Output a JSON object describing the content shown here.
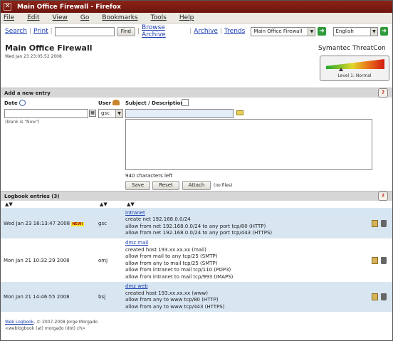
{
  "window": {
    "title": "Main Office Firewall - Firefox"
  },
  "menu": [
    "File",
    "Edit",
    "View",
    "Go",
    "Bookmarks",
    "Tools",
    "Help"
  ],
  "nav": {
    "search": "Search",
    "print": "Print",
    "search_value": "",
    "find_button": "Find",
    "browse_archive": "Browse Archive",
    "archive": "Archive",
    "trends": "Trends",
    "logbook_select": "Main Office Firewall",
    "language_select": "English"
  },
  "page": {
    "title": "Main Office Firewall",
    "date": "Wed Jan 23 23:05:52 2008"
  },
  "threatcon": {
    "title": "Symantec ThreatCon",
    "level_text": "Level 1: Normal",
    "level_fraction": 0.25
  },
  "new_entry": {
    "section_title": "Add a new entry",
    "date_label": "Date",
    "date_hint": "(blank is \"Now\")",
    "user_label": "User",
    "user_value": "gsc",
    "subject_label": "Subject / Description",
    "subject_value": "",
    "description_value": "",
    "chars_left": "940 characters left",
    "save": "Save",
    "reset": "Reset",
    "attach": "Attach",
    "no_files": "(no files)"
  },
  "logbook": {
    "section_title": "Logbook entries (3)",
    "entries": [
      {
        "date": "Wed Jan 23 16:13:47 2008",
        "new": "NEW!",
        "user": "gsc",
        "subject": "intranet",
        "lines": [
          "create net 192.168.0.0/24",
          "allow from net 192.168.0.0/24 to any port tcp/80 (HTTP)",
          "allow from net 192.168.0.0/24 to any port tcp/443 (HTTPS)"
        ]
      },
      {
        "date": "Mon Jan 21 10:32:29 2008",
        "new": "",
        "user": "omj",
        "subject": "dmz mail",
        "lines": [
          "created host 193.xx.xx.xx (mail)",
          "allow from mail to any tcp/25 (SMTP)",
          "allow from any to mail tcp/25 (SMTP)",
          "allow from intranet to mail tcp/110 (POP3)",
          "allow from intranet to mail tcp/993 (IMAPS)"
        ]
      },
      {
        "date": "Mon Jan 21 14:46:55 2008",
        "new": "",
        "user": "bsj",
        "subject": "dmz web",
        "lines": [
          "created host 193.xx.xx.xx (www)",
          "allow from any to www tcp/80 (HTTP)",
          "allow from any to www tcp/443 (HTTPS)"
        ]
      }
    ]
  },
  "footer": {
    "line1_link": "Web Logbook",
    "line1_rest": ", © 2007-2008 Jorge Morgado",
    "line2": "<weblogbook (at) morgado (dot) ch>"
  }
}
